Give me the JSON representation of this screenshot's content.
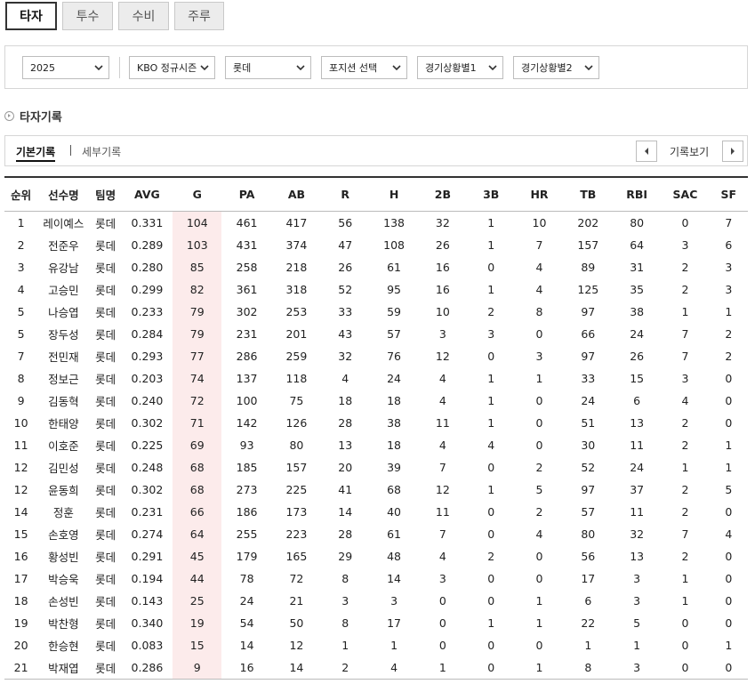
{
  "tabs": [
    "타자",
    "투수",
    "수비",
    "주루"
  ],
  "filters": {
    "season": "2025",
    "series": "KBO 정규시즌",
    "team": "롯데",
    "position": "포지션 선택",
    "situation1": "경기상황별1",
    "situation2": "경기상황별2"
  },
  "section_title": "타자기록",
  "subtabs": {
    "basic": "기본기록",
    "detail": "세부기록"
  },
  "pager_label": "기록보기",
  "columns": [
    "순위",
    "선수명",
    "팀명",
    "AVG",
    "G",
    "PA",
    "AB",
    "R",
    "H",
    "2B",
    "3B",
    "HR",
    "TB",
    "RBI",
    "SAC",
    "SF"
  ],
  "rows": [
    [
      "1",
      "레이예스",
      "롯데",
      "0.331",
      "104",
      "461",
      "417",
      "56",
      "138",
      "32",
      "1",
      "10",
      "202",
      "80",
      "0",
      "7"
    ],
    [
      "2",
      "전준우",
      "롯데",
      "0.289",
      "103",
      "431",
      "374",
      "47",
      "108",
      "26",
      "1",
      "7",
      "157",
      "64",
      "3",
      "6"
    ],
    [
      "3",
      "유강남",
      "롯데",
      "0.280",
      "85",
      "258",
      "218",
      "26",
      "61",
      "16",
      "0",
      "4",
      "89",
      "31",
      "2",
      "3"
    ],
    [
      "4",
      "고승민",
      "롯데",
      "0.299",
      "82",
      "361",
      "318",
      "52",
      "95",
      "16",
      "1",
      "4",
      "125",
      "35",
      "2",
      "3"
    ],
    [
      "5",
      "나승엽",
      "롯데",
      "0.233",
      "79",
      "302",
      "253",
      "33",
      "59",
      "10",
      "2",
      "8",
      "97",
      "38",
      "1",
      "1"
    ],
    [
      "5",
      "장두성",
      "롯데",
      "0.284",
      "79",
      "231",
      "201",
      "43",
      "57",
      "3",
      "3",
      "0",
      "66",
      "24",
      "7",
      "2"
    ],
    [
      "7",
      "전민재",
      "롯데",
      "0.293",
      "77",
      "286",
      "259",
      "32",
      "76",
      "12",
      "0",
      "3",
      "97",
      "26",
      "7",
      "2"
    ],
    [
      "8",
      "정보근",
      "롯데",
      "0.203",
      "74",
      "137",
      "118",
      "4",
      "24",
      "4",
      "1",
      "1",
      "33",
      "15",
      "3",
      "0"
    ],
    [
      "9",
      "김동혁",
      "롯데",
      "0.240",
      "72",
      "100",
      "75",
      "18",
      "18",
      "4",
      "1",
      "0",
      "24",
      "6",
      "4",
      "0"
    ],
    [
      "10",
      "한태양",
      "롯데",
      "0.302",
      "71",
      "142",
      "126",
      "28",
      "38",
      "11",
      "1",
      "0",
      "51",
      "13",
      "2",
      "0"
    ],
    [
      "11",
      "이호준",
      "롯데",
      "0.225",
      "69",
      "93",
      "80",
      "13",
      "18",
      "4",
      "4",
      "0",
      "30",
      "11",
      "2",
      "1"
    ],
    [
      "12",
      "김민성",
      "롯데",
      "0.248",
      "68",
      "185",
      "157",
      "20",
      "39",
      "7",
      "0",
      "2",
      "52",
      "24",
      "1",
      "1"
    ],
    [
      "12",
      "윤동희",
      "롯데",
      "0.302",
      "68",
      "273",
      "225",
      "41",
      "68",
      "12",
      "1",
      "5",
      "97",
      "37",
      "2",
      "5"
    ],
    [
      "14",
      "정훈",
      "롯데",
      "0.231",
      "66",
      "186",
      "173",
      "14",
      "40",
      "11",
      "0",
      "2",
      "57",
      "11",
      "2",
      "0"
    ],
    [
      "15",
      "손호영",
      "롯데",
      "0.274",
      "64",
      "255",
      "223",
      "28",
      "61",
      "7",
      "0",
      "4",
      "80",
      "32",
      "7",
      "4"
    ],
    [
      "16",
      "황성빈",
      "롯데",
      "0.291",
      "45",
      "179",
      "165",
      "29",
      "48",
      "4",
      "2",
      "0",
      "56",
      "13",
      "2",
      "0"
    ],
    [
      "17",
      "박승욱",
      "롯데",
      "0.194",
      "44",
      "78",
      "72",
      "8",
      "14",
      "3",
      "0",
      "0",
      "17",
      "3",
      "1",
      "0"
    ],
    [
      "18",
      "손성빈",
      "롯데",
      "0.143",
      "25",
      "24",
      "21",
      "3",
      "3",
      "0",
      "0",
      "1",
      "6",
      "3",
      "1",
      "0"
    ],
    [
      "19",
      "박찬형",
      "롯데",
      "0.340",
      "19",
      "54",
      "50",
      "8",
      "17",
      "0",
      "1",
      "1",
      "22",
      "5",
      "0",
      "0"
    ],
    [
      "20",
      "한승현",
      "롯데",
      "0.083",
      "15",
      "14",
      "12",
      "1",
      "1",
      "0",
      "0",
      "0",
      "1",
      "1",
      "0",
      "1"
    ],
    [
      "21",
      "박재엽",
      "롯데",
      "0.286",
      "9",
      "16",
      "14",
      "2",
      "4",
      "1",
      "0",
      "1",
      "8",
      "3",
      "0",
      "0"
    ]
  ],
  "highlight_column_color": "#fcebeb"
}
